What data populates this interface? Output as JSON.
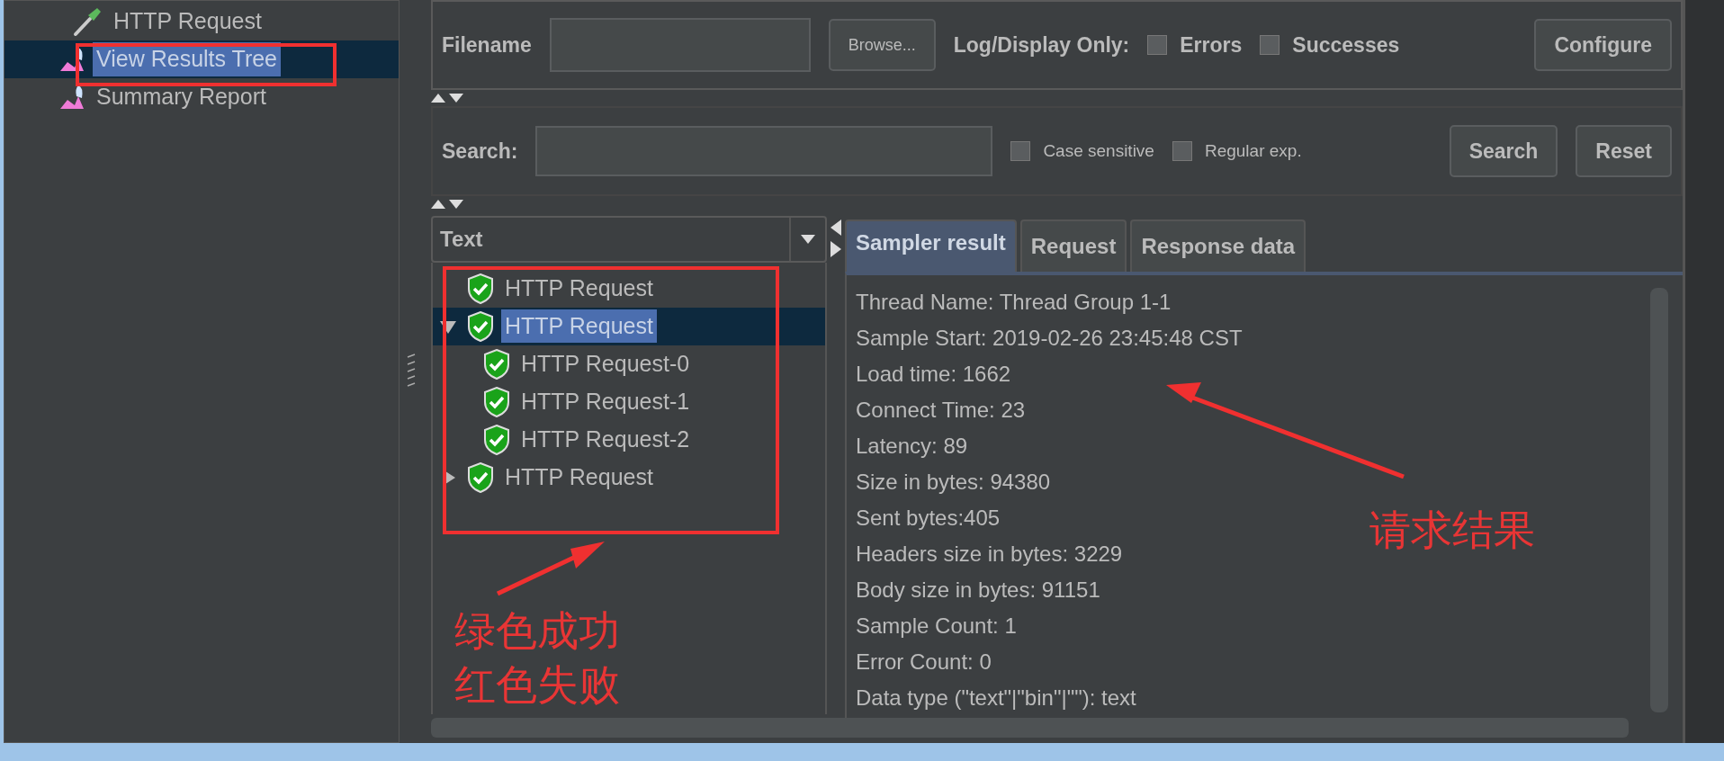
{
  "sidebar_tree": {
    "items": [
      {
        "label": "HTTP Request",
        "kind": "sampler",
        "selected": false
      },
      {
        "label": "View Results Tree",
        "kind": "listener",
        "selected": true
      },
      {
        "label": "Summary Report",
        "kind": "listener",
        "selected": false
      }
    ]
  },
  "file_row": {
    "filename_label": "Filename",
    "browse_button": "Browse...",
    "log_display_label": "Log/Display Only:",
    "options": [
      {
        "label": "Errors",
        "checked": false
      },
      {
        "label": "Successes",
        "checked": false
      }
    ],
    "configure_button": "Configure"
  },
  "search_row": {
    "label": "Search:",
    "options": [
      {
        "label": "Case sensitive",
        "checked": false
      },
      {
        "label": "Regular exp.",
        "checked": false
      }
    ],
    "buttons": [
      "Search",
      "Reset"
    ]
  },
  "renderer": {
    "value": "Text"
  },
  "results_tree": [
    {
      "label": "HTTP Request",
      "failed": false,
      "selected": false
    },
    {
      "label": "HTTP Request",
      "failed": false,
      "selected": true,
      "expanded": true,
      "children": [
        {
          "label": "HTTP Request-0",
          "failed": false,
          "selected": false
        },
        {
          "label": "HTTP Request-1",
          "failed": false,
          "selected": false
        },
        {
          "label": "HTTP Request-2",
          "failed": false,
          "selected": false
        }
      ]
    },
    {
      "label": "HTTP Request",
      "failed": false,
      "selected": false,
      "expanded": false
    }
  ],
  "tabs": [
    {
      "label": "Sampler result",
      "selected": true
    },
    {
      "label": "Request",
      "selected": false
    },
    {
      "label": "Response data",
      "selected": false
    }
  ],
  "result_lines": [
    "Thread Name: Thread Group 1-1",
    "Sample Start: 2019-02-26 23:45:48 CST",
    "Load time: 1662",
    "Connect Time: 23",
    "Latency: 89",
    "Size in bytes: 94380",
    "Sent bytes:405",
    "Headers size in bytes: 3229",
    "Body size in bytes: 91151",
    "Sample Count: 1",
    "Error Count: 0",
    "Data type (\"text\"|\"bin\"|\"\"): text"
  ],
  "annotations": {
    "tree_note": [
      "绿色成功",
      "红色失败"
    ],
    "result_note": "请求结果"
  }
}
